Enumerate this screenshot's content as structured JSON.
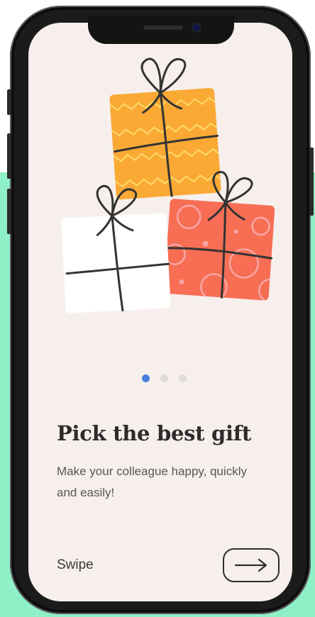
{
  "onboarding": {
    "title": "Pick the best gift",
    "subtitle": "Make your colleague happy, quickly and easily!",
    "swipe_label": "Swipe",
    "pagination": {
      "current": 1,
      "total": 3,
      "active_color": "#4a7fe0",
      "inactive_color": "#e0dada"
    },
    "next_button_icon": "arrow-right-icon"
  },
  "colors": {
    "screen_background": "#f7efec",
    "backdrop": "#8ff0c8",
    "gift_yellow": "#f9a934",
    "gift_white": "#ffffff",
    "gift_red": "#f76e55"
  },
  "illustration": {
    "gifts": [
      "yellow-gift-icon",
      "white-gift-icon",
      "red-gift-icon"
    ]
  }
}
